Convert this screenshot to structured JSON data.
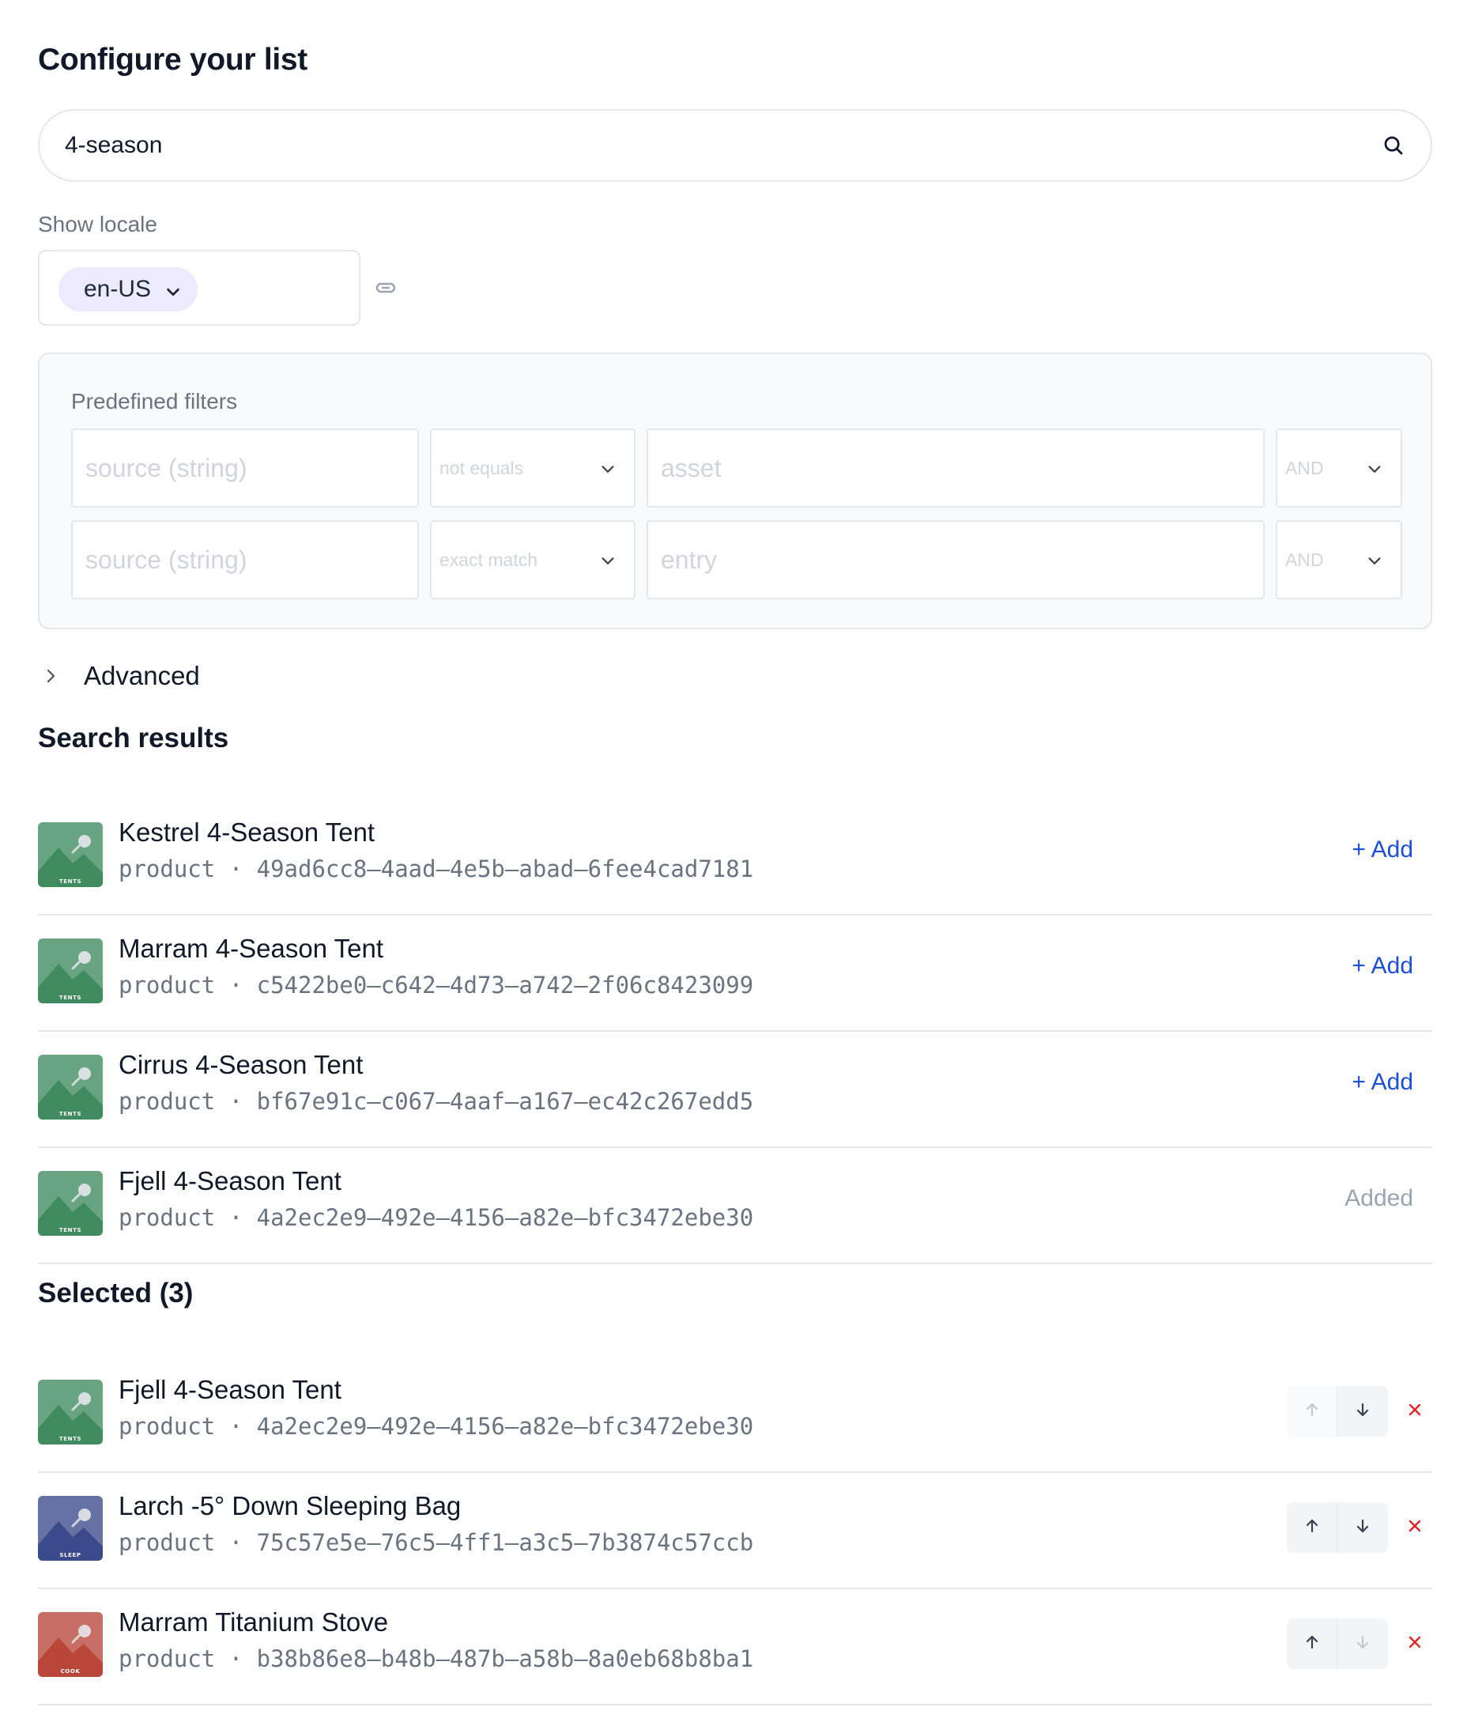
{
  "page": {
    "title": "Configure your list"
  },
  "search": {
    "value": "4-season"
  },
  "locale": {
    "label": "Show locale",
    "selected": "en-US"
  },
  "filters": {
    "label": "Predefined filters",
    "rows": [
      {
        "field": "source (string)",
        "operator": "not equals",
        "value": "asset",
        "logic": "AND"
      },
      {
        "field": "source (string)",
        "operator": "exact match",
        "value": "entry",
        "logic": "AND"
      }
    ]
  },
  "advanced": {
    "label": "Advanced"
  },
  "results": {
    "title": "Search results",
    "add_label": "+ Add",
    "added_label": "Added",
    "items": [
      {
        "name": "Kestrel 4-Season Tent",
        "type": "product",
        "sep": "·",
        "id": "49ad6cc8–4aad–4e5b–abad–6fee4cad7181",
        "category": "TENTS",
        "added": false
      },
      {
        "name": "Marram 4-Season Tent",
        "type": "product",
        "sep": "·",
        "id": "c5422be0–c642–4d73–a742–2f06c8423099",
        "category": "TENTS",
        "added": false
      },
      {
        "name": "Cirrus 4-Season Tent",
        "type": "product",
        "sep": "·",
        "id": "bf67e91c–c067–4aaf–a167–ec42c267edd5",
        "category": "TENTS",
        "added": false
      },
      {
        "name": "Fjell 4-Season Tent",
        "type": "product",
        "sep": "·",
        "id": "4a2ec2e9–492e–4156–a82e–bfc3472ebe30",
        "category": "TENTS",
        "added": true
      }
    ]
  },
  "selected": {
    "title": "Selected (3)",
    "items": [
      {
        "name": "Fjell 4-Season Tent",
        "type": "product",
        "sep": "·",
        "id": "4a2ec2e9–492e–4156–a82e–bfc3472ebe30",
        "category": "TENTS"
      },
      {
        "name": "Larch -5° Down Sleeping Bag",
        "type": "product",
        "sep": "·",
        "id": "75c57e5e–76c5–4ff1–a3c5–7b3874c57ccb",
        "category": "SLEEP"
      },
      {
        "name": "Marram Titanium Stove",
        "type": "product",
        "sep": "·",
        "id": "b38b86e8–b48b–487b–a58b–8a0eb68b8ba1",
        "category": "COOK"
      }
    ]
  },
  "icons": {
    "search": "search-icon",
    "link": "link-icon",
    "chevron": "chevron-down-icon",
    "expand": "chevron-right-icon",
    "up": "arrow-up-icon",
    "down": "arrow-down-icon",
    "remove": "close-icon"
  },
  "colors": {
    "accent": "#1d4ed8",
    "remove": "#dc2626",
    "locale_pill": "#ede9fe",
    "tents": "#3f8a5f",
    "sleep": "#3b4a8a",
    "cook": "#b8473a"
  }
}
